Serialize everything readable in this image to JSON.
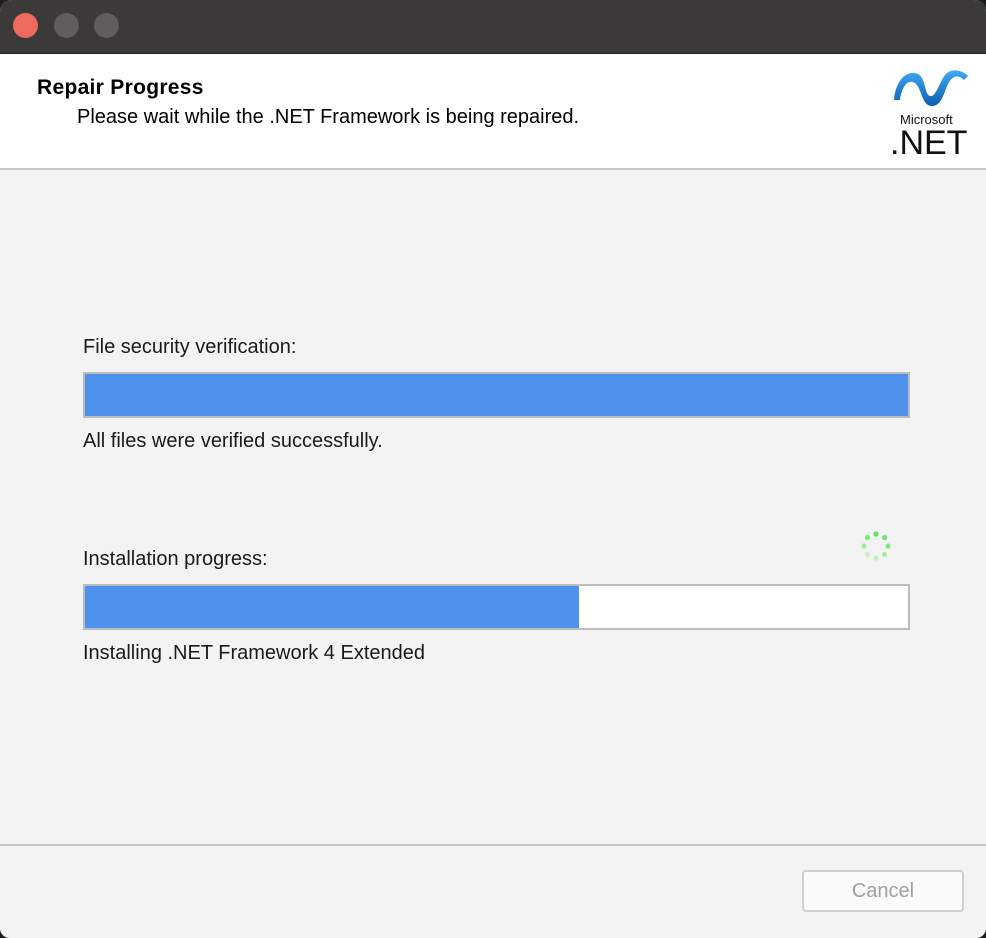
{
  "window": {
    "controls": [
      "close",
      "minimize",
      "maximize"
    ]
  },
  "header": {
    "title": "Repair Progress",
    "subtitle": "Please wait while the .NET Framework is being repaired.",
    "logo_top": "Microsoft",
    "logo_bottom": ".NET"
  },
  "verification": {
    "label": "File security verification:",
    "progress": 1.0,
    "status": "All files were verified successfully."
  },
  "installation": {
    "label": "Installation progress:",
    "progress": 0.6,
    "status": "Installing .NET Framework 4 Extended"
  },
  "footer": {
    "cancel_label": "Cancel"
  },
  "colors": {
    "progress_fill": "#4f92ee",
    "close_button": "#ee6a5e",
    "spinner": "#5ee55e"
  }
}
